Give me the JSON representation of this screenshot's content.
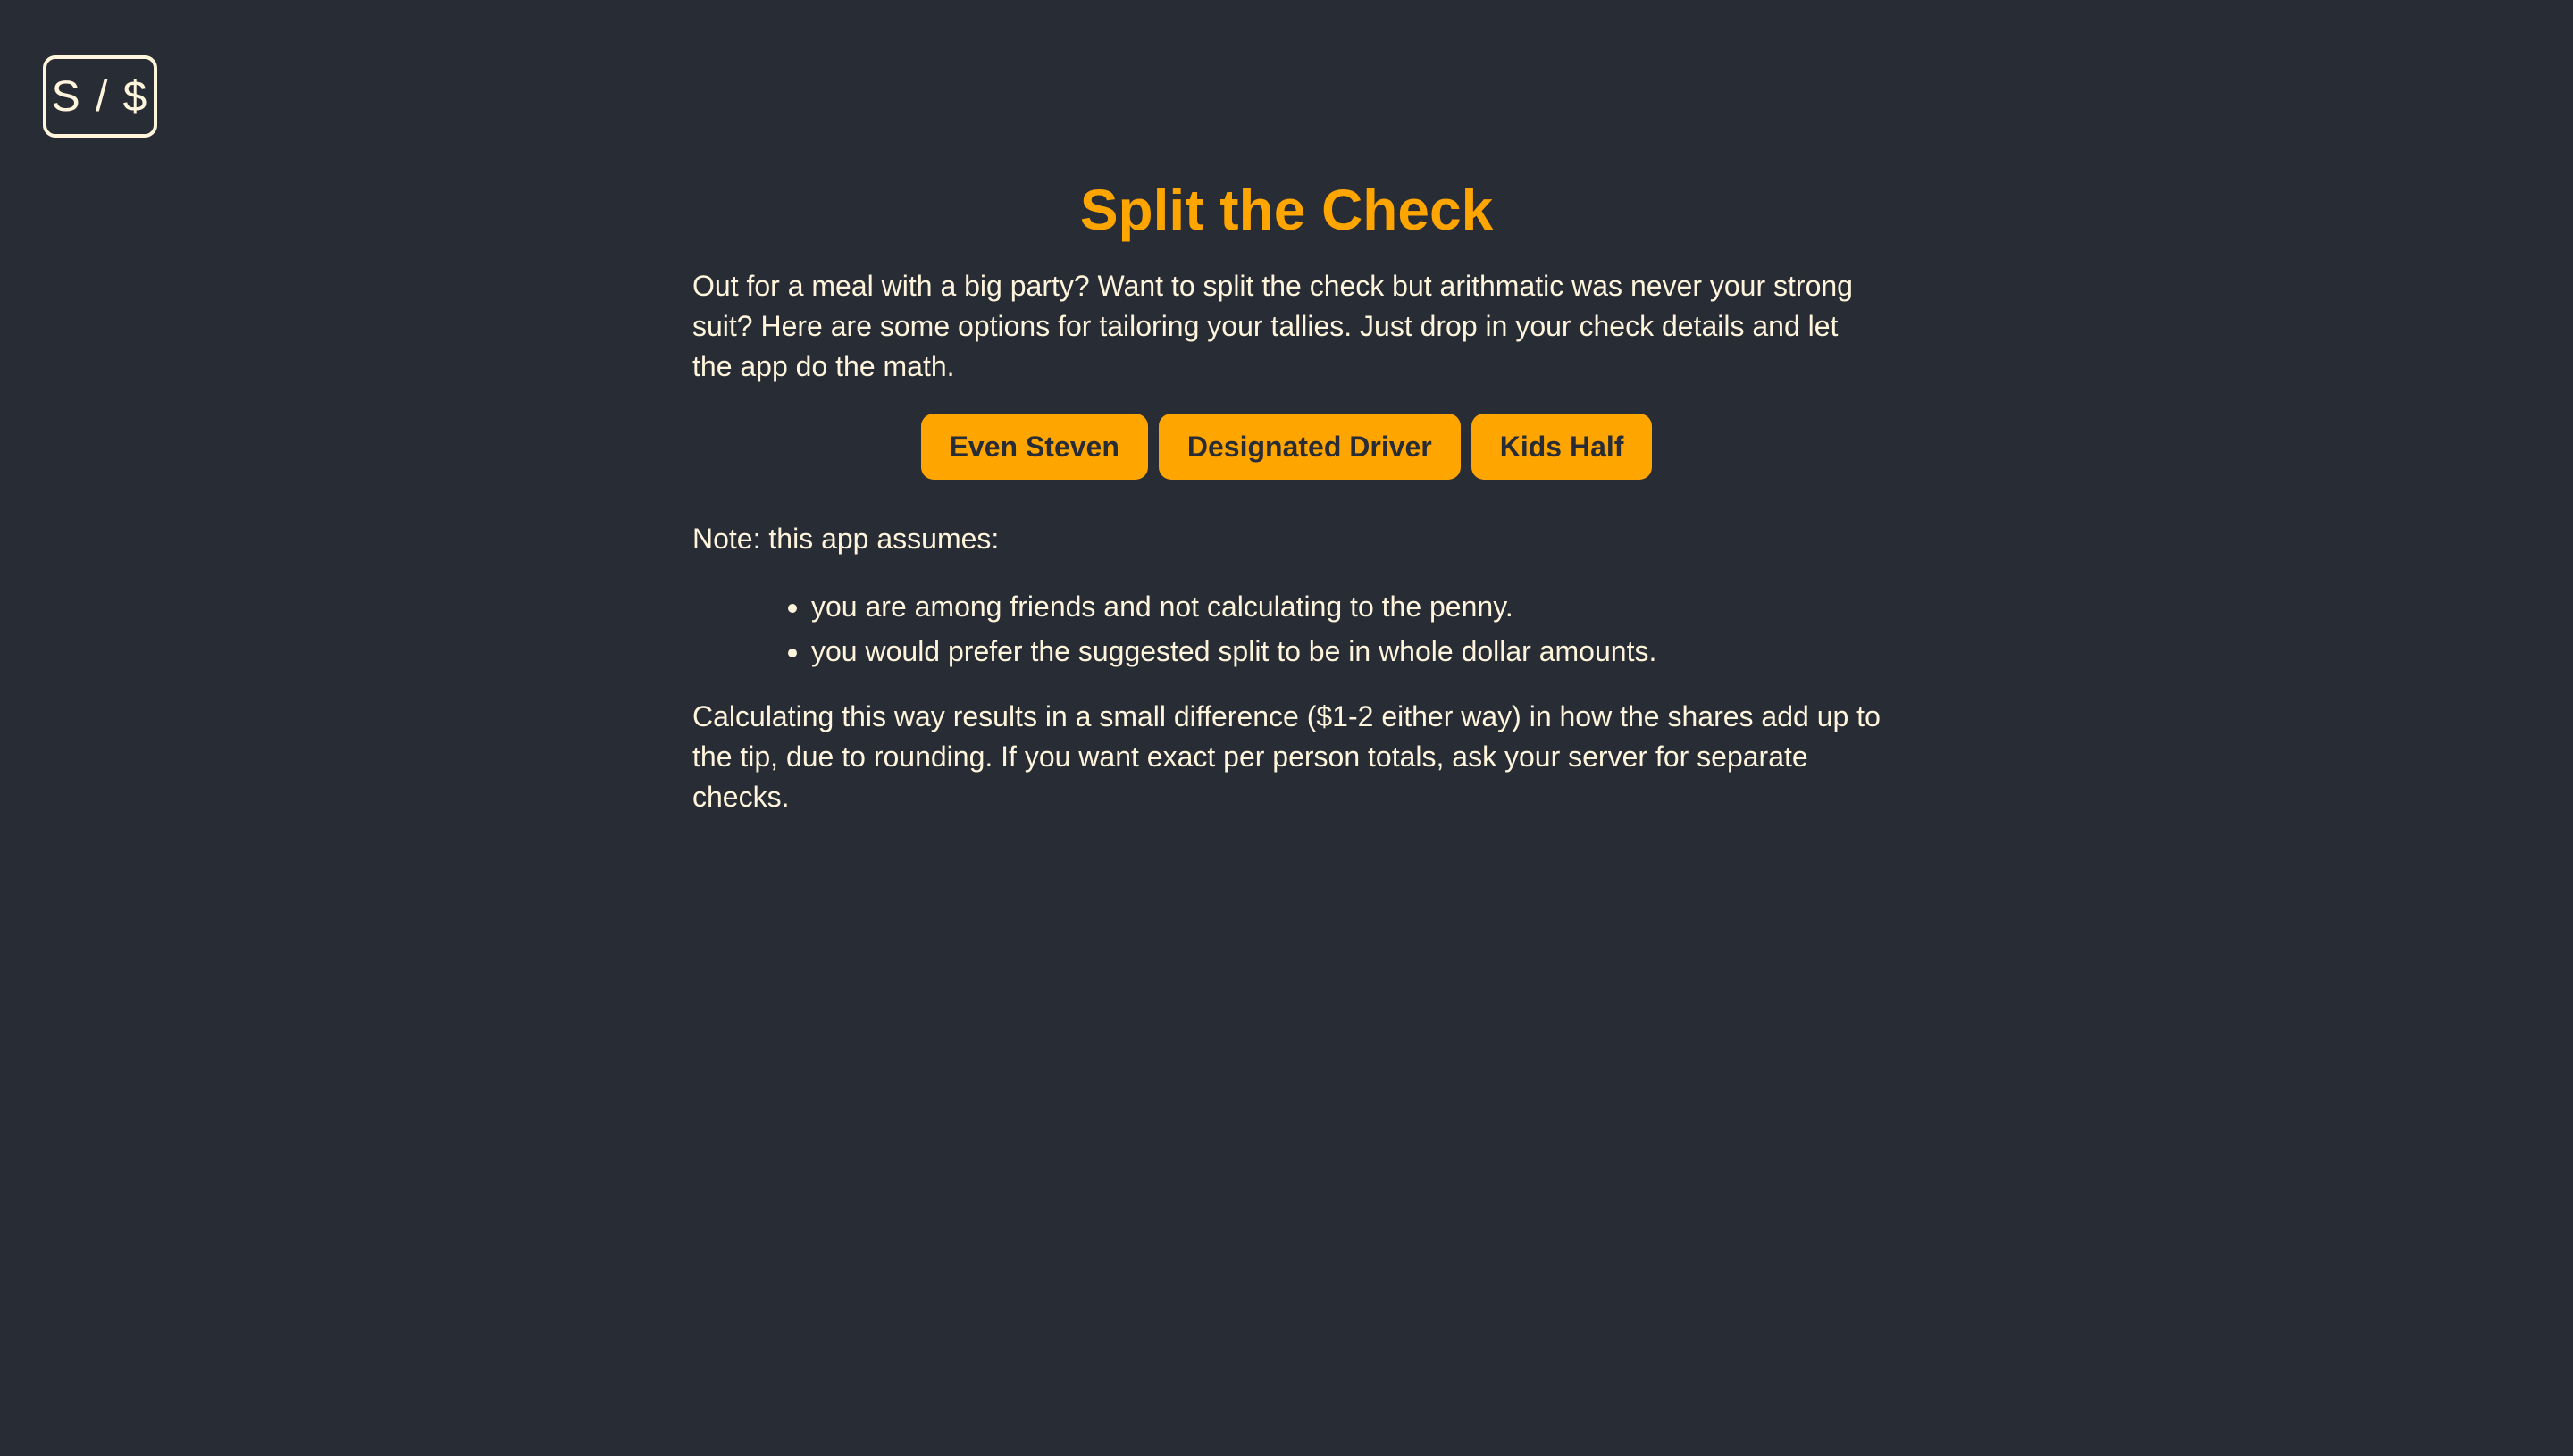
{
  "logo": {
    "text": "S / $"
  },
  "page": {
    "title": "Split the Check",
    "intro": "Out for a meal with a big party? Want to split the check but arithmatic was never your strong suit? Here are some options for tailoring your tallies. Just drop in your check details and let the app do the math.",
    "buttons": [
      {
        "label": "Even Steven"
      },
      {
        "label": "Designated Driver"
      },
      {
        "label": "Kids Half"
      }
    ],
    "note": "Note: this app assumes:",
    "assumptions": [
      "you are among friends and not calculating to the penny.",
      "you would prefer the suggested split to be in whole dollar amounts."
    ],
    "outro": "Calculating this way results in a small difference ($1-2 either way) in how the shares add up to the tip, due to rounding. If you want exact per person totals, ask your server for separate checks."
  },
  "colors": {
    "background": "#282c34",
    "accent": "#ffa500",
    "text": "#fff5dc"
  }
}
